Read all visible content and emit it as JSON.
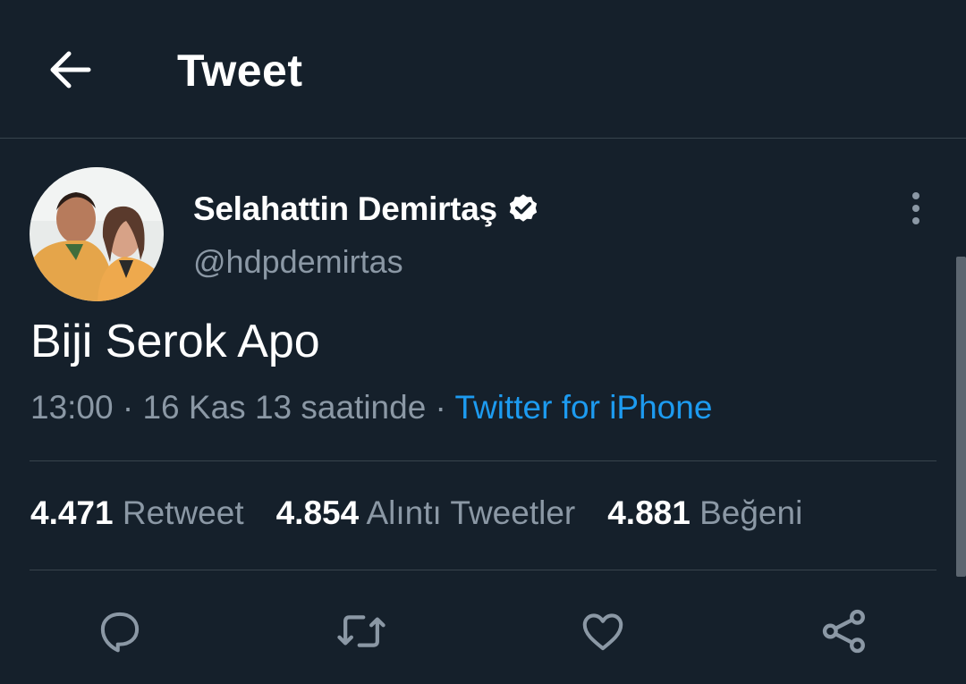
{
  "header": {
    "title": "Tweet",
    "back_icon": "arrow-left-icon"
  },
  "tweet": {
    "author": {
      "display_name": "Selahattin Demirtaş",
      "handle": "@hdpdemirtas",
      "verified": true
    },
    "text": "Biji Serok Apo",
    "meta": {
      "time": "13:00",
      "separator": " · ",
      "date": "16 Kas 13 saatinde",
      "source": "Twitter for iPhone"
    },
    "stats": [
      {
        "value": "4.471",
        "label": "Retweet"
      },
      {
        "value": "4.854",
        "label": "Alıntı Tweetler"
      },
      {
        "value": "4.881",
        "label": "Beğeni"
      }
    ]
  },
  "actions": [
    "reply-icon",
    "retweet-icon",
    "like-icon",
    "share-icon"
  ],
  "colors": {
    "background": "#15202b",
    "divider": "#38444d",
    "secondary_text": "#8b98a5",
    "accent": "#1d9bf0"
  }
}
